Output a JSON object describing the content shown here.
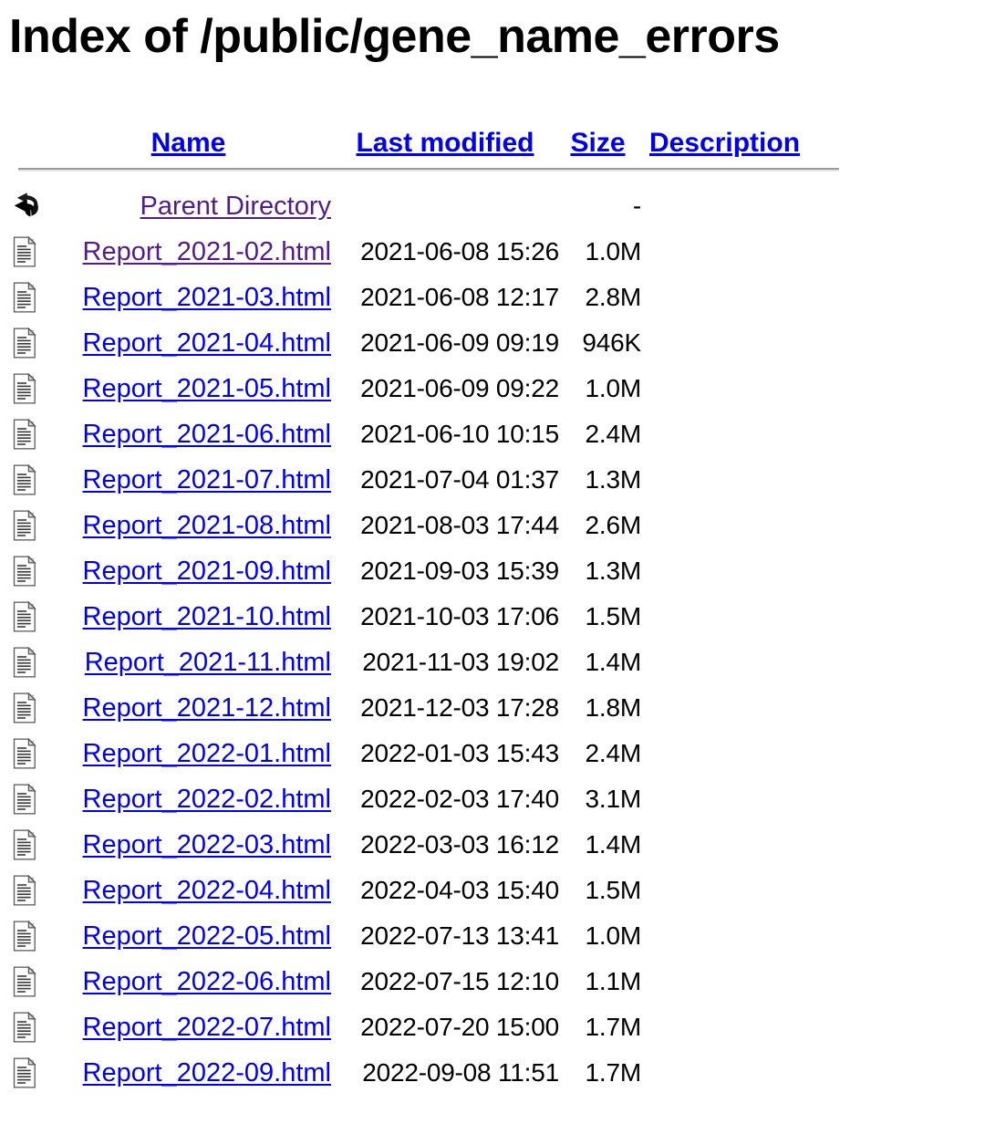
{
  "page": {
    "title": "Index of /public/gene_name_errors",
    "directory_path": "/public/gene_name_errors"
  },
  "colors": {
    "link_unvisited": "#0000EE",
    "link_visited": "#551A8B",
    "text": "#000000",
    "background": "#FFFFFF",
    "rule": "#9A9A9A"
  },
  "table": {
    "headers": {
      "name": "Name",
      "last_modified": "Last modified",
      "size": "Size",
      "description": "Description"
    },
    "parent": {
      "icon": "back-arrow-icon",
      "label": "Parent Directory",
      "last_modified": "",
      "size": "-",
      "description": "",
      "visited": true
    },
    "rows": [
      {
        "icon": "text-file-icon",
        "name": "Report_2021-02.html",
        "last_modified": "2021-06-08 15:26",
        "size": "1.0M",
        "description": "",
        "visited": true
      },
      {
        "icon": "text-file-icon",
        "name": "Report_2021-03.html",
        "last_modified": "2021-06-08 12:17",
        "size": "2.8M",
        "description": "",
        "visited": false
      },
      {
        "icon": "text-file-icon",
        "name": "Report_2021-04.html",
        "last_modified": "2021-06-09 09:19",
        "size": "946K",
        "description": "",
        "visited": false
      },
      {
        "icon": "text-file-icon",
        "name": "Report_2021-05.html",
        "last_modified": "2021-06-09 09:22",
        "size": "1.0M",
        "description": "",
        "visited": false
      },
      {
        "icon": "text-file-icon",
        "name": "Report_2021-06.html",
        "last_modified": "2021-06-10 10:15",
        "size": "2.4M",
        "description": "",
        "visited": false
      },
      {
        "icon": "text-file-icon",
        "name": "Report_2021-07.html",
        "last_modified": "2021-07-04 01:37",
        "size": "1.3M",
        "description": "",
        "visited": false
      },
      {
        "icon": "text-file-icon",
        "name": "Report_2021-08.html",
        "last_modified": "2021-08-03 17:44",
        "size": "2.6M",
        "description": "",
        "visited": false
      },
      {
        "icon": "text-file-icon",
        "name": "Report_2021-09.html",
        "last_modified": "2021-09-03 15:39",
        "size": "1.3M",
        "description": "",
        "visited": false
      },
      {
        "icon": "text-file-icon",
        "name": "Report_2021-10.html",
        "last_modified": "2021-10-03 17:06",
        "size": "1.5M",
        "description": "",
        "visited": false
      },
      {
        "icon": "text-file-icon",
        "name": "Report_2021-11.html",
        "last_modified": "2021-11-03 19:02",
        "size": "1.4M",
        "description": "",
        "visited": false
      },
      {
        "icon": "text-file-icon",
        "name": "Report_2021-12.html",
        "last_modified": "2021-12-03 17:28",
        "size": "1.8M",
        "description": "",
        "visited": false
      },
      {
        "icon": "text-file-icon",
        "name": "Report_2022-01.html",
        "last_modified": "2022-01-03 15:43",
        "size": "2.4M",
        "description": "",
        "visited": false
      },
      {
        "icon": "text-file-icon",
        "name": "Report_2022-02.html",
        "last_modified": "2022-02-03 17:40",
        "size": "3.1M",
        "description": "",
        "visited": false
      },
      {
        "icon": "text-file-icon",
        "name": "Report_2022-03.html",
        "last_modified": "2022-03-03 16:12",
        "size": "1.4M",
        "description": "",
        "visited": false
      },
      {
        "icon": "text-file-icon",
        "name": "Report_2022-04.html",
        "last_modified": "2022-04-03 15:40",
        "size": "1.5M",
        "description": "",
        "visited": false
      },
      {
        "icon": "text-file-icon",
        "name": "Report_2022-05.html",
        "last_modified": "2022-07-13 13:41",
        "size": "1.0M",
        "description": "",
        "visited": false
      },
      {
        "icon": "text-file-icon",
        "name": "Report_2022-06.html",
        "last_modified": "2022-07-15 12:10",
        "size": "1.1M",
        "description": "",
        "visited": false
      },
      {
        "icon": "text-file-icon",
        "name": "Report_2022-07.html",
        "last_modified": "2022-07-20 15:00",
        "size": "1.7M",
        "description": "",
        "visited": false
      },
      {
        "icon": "text-file-icon",
        "name": "Report_2022-09.html",
        "last_modified": "2022-09-08 11:51",
        "size": "1.7M",
        "description": "",
        "visited": false
      }
    ]
  }
}
